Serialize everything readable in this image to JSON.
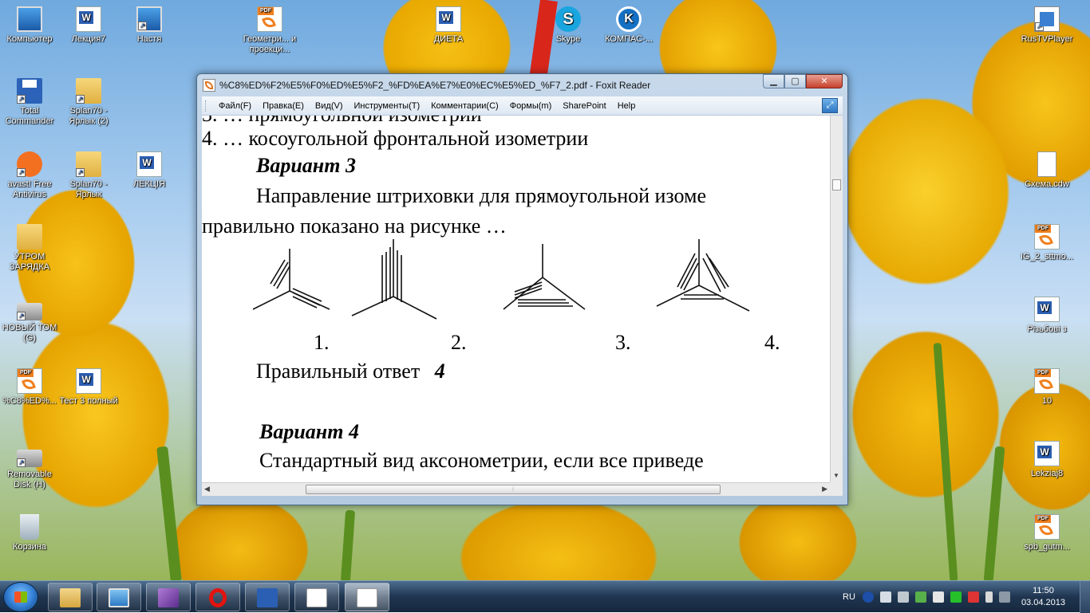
{
  "desktop": {
    "icons_left": [
      {
        "label": "Компьютер",
        "icon": "computer-icon"
      },
      {
        "label": "Лекция7",
        "icon": "word-doc-icon"
      },
      {
        "label": "Настя",
        "icon": "folder-shortcut-icon"
      },
      {
        "label": "Геометри... и проекци...",
        "icon": "pdf-icon"
      },
      {
        "label": "ДИЕТА",
        "icon": "word-doc-icon"
      },
      {
        "label": "Skype",
        "icon": "skype-icon"
      },
      {
        "label": "КОМПАС-...",
        "icon": "kompas-icon"
      },
      {
        "label": "Total Commander",
        "icon": "floppy-icon"
      },
      {
        "label": "Splan70 - Ярлык (2)",
        "icon": "folder-shortcut-icon"
      },
      {
        "label": "avast! Free Antivirus",
        "icon": "avast-icon"
      },
      {
        "label": "Splan70 - Ярлык",
        "icon": "folder-shortcut-icon"
      },
      {
        "label": "ЛЕКЦІЯ",
        "icon": "word-doc-icon"
      },
      {
        "label": "УТРОМ ЗАРЯДКА",
        "icon": "folder-icon"
      },
      {
        "label": "НОВЫЙ ТОМ (G)",
        "icon": "drive-icon"
      },
      {
        "label": "%C8%ED%...",
        "icon": "pdf-icon"
      },
      {
        "label": "Тест 3 полный",
        "icon": "word-doc-icon"
      },
      {
        "label": "Removable Disk (H)",
        "icon": "drive-icon"
      },
      {
        "label": "Корзина",
        "icon": "recycle-bin-icon"
      }
    ],
    "icons_right": [
      {
        "label": "RusTVPlayer",
        "icon": "tv-player-icon"
      },
      {
        "label": "Схема.cdw",
        "icon": "file-icon"
      },
      {
        "label": "IG_2_sttmo...",
        "icon": "pdf-icon"
      },
      {
        "label": "Різьбові з",
        "icon": "word-doc-icon"
      },
      {
        "label": "10",
        "icon": "pdf-icon"
      },
      {
        "label": "Lekziaj8",
        "icon": "word-doc-icon"
      },
      {
        "label": "spb_gutm...",
        "icon": "pdf-icon"
      }
    ]
  },
  "window": {
    "title": "%C8%ED%F2%E5%F0%ED%E5%F2_%FD%EA%E7%E0%EC%E5%ED_%F7_2.pdf - Foxit Reader",
    "buttons": {
      "minimize": "▁",
      "maximize": "▢",
      "close": "✕"
    },
    "menu": [
      "Файл(F)",
      "Правка(E)",
      "Вид(V)",
      "Инструменты(T)",
      "Комментарии(C)",
      "Формы(m)",
      "SharePoint",
      "Help"
    ],
    "expand_icon": "expand-icon"
  },
  "document": {
    "line_cut_top": "3. … прямоугольной изометрии",
    "line_option4": "4. … косоугольной фронтальной изометрии",
    "variant3_title": "Вариант 3",
    "variant3_q1": "Направление штриховки для прямоугольной изоме",
    "variant3_q2": "правильно показано на рисунке …",
    "figure_labels": [
      "1.",
      "2.",
      "3.",
      "4."
    ],
    "answer_label": "Правильный ответ",
    "answer_value": "4",
    "variant4_title": "Вариант 4",
    "variant4_q1": "Стандартный вид аксонометрии, если все приведе"
  },
  "taskbar": {
    "apps": [
      {
        "name": "explorer",
        "icon": "explorer-icon"
      },
      {
        "name": "media",
        "icon": "media-player-icon"
      },
      {
        "name": "visual-studio",
        "icon": "visual-studio-icon"
      },
      {
        "name": "opera",
        "icon": "opera-icon"
      },
      {
        "name": "total-commander",
        "icon": "floppy-icon"
      },
      {
        "name": "word",
        "icon": "word-icon"
      },
      {
        "name": "foxit",
        "icon": "foxit-icon"
      }
    ],
    "language": "RU",
    "time": "11:50",
    "date": "03.04.2013"
  }
}
